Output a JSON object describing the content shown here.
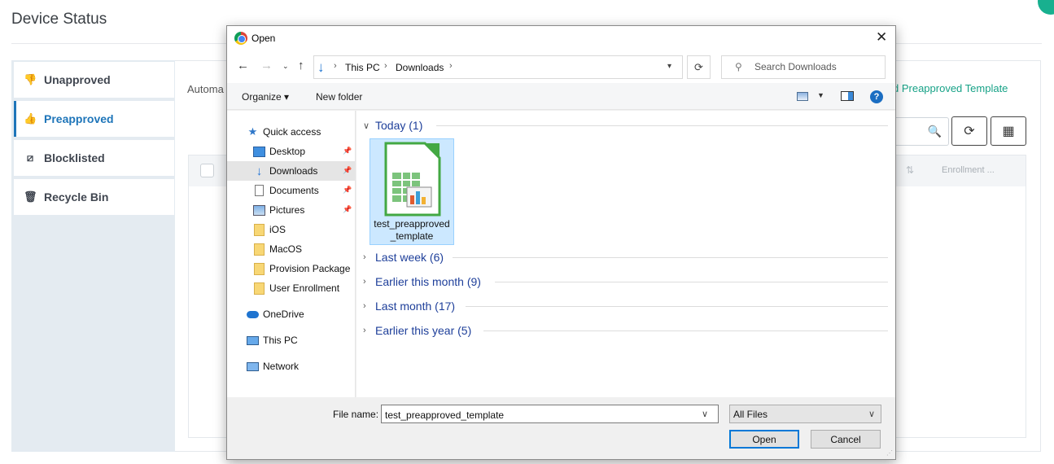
{
  "page": {
    "title": "Device Status",
    "automa_text": "Automa",
    "template_link": "d Preapproved Template",
    "table_header_enrollment": "Enrollment ...",
    "refresh_icon": "refresh-icon",
    "grid_icon": "grid-icon"
  },
  "sidebar": {
    "items": [
      {
        "label": "Unapproved",
        "icon": "thumbs-down-icon"
      },
      {
        "label": "Preapproved",
        "icon": "thumbs-up-icon"
      },
      {
        "label": "Blocklisted",
        "icon": "block-icon"
      },
      {
        "label": "Recycle Bin",
        "icon": "trash-icon"
      }
    ],
    "active_index": 1,
    "accent": "#1e75b9"
  },
  "dialog": {
    "title": "Open",
    "address": {
      "root": "This PC",
      "folder": "Downloads"
    },
    "search_placeholder": "Search Downloads",
    "toolbar": {
      "organize": "Organize",
      "new_folder": "New folder"
    },
    "nav": {
      "quick_access": "Quick access",
      "items": [
        "Desktop",
        "Downloads",
        "Documents",
        "Pictures",
        "iOS",
        "MacOS",
        "Provision Package",
        "User Enrollment"
      ],
      "onedrive": "OneDrive",
      "this_pc": "This PC",
      "network": "Network"
    },
    "groups": {
      "today": "Today (1)",
      "last_week": "Last week (6)",
      "earlier_month": "Earlier this month (9)",
      "last_month": "Last month (17)",
      "earlier_year": "Earlier this year (5)"
    },
    "file": {
      "name_line1": "test_preapproved",
      "name_line2": "_template"
    },
    "file_name_label": "File name:",
    "file_name_value": "test_preapproved_template",
    "file_type": "All Files",
    "open_button": "Open",
    "cancel_button": "Cancel"
  }
}
